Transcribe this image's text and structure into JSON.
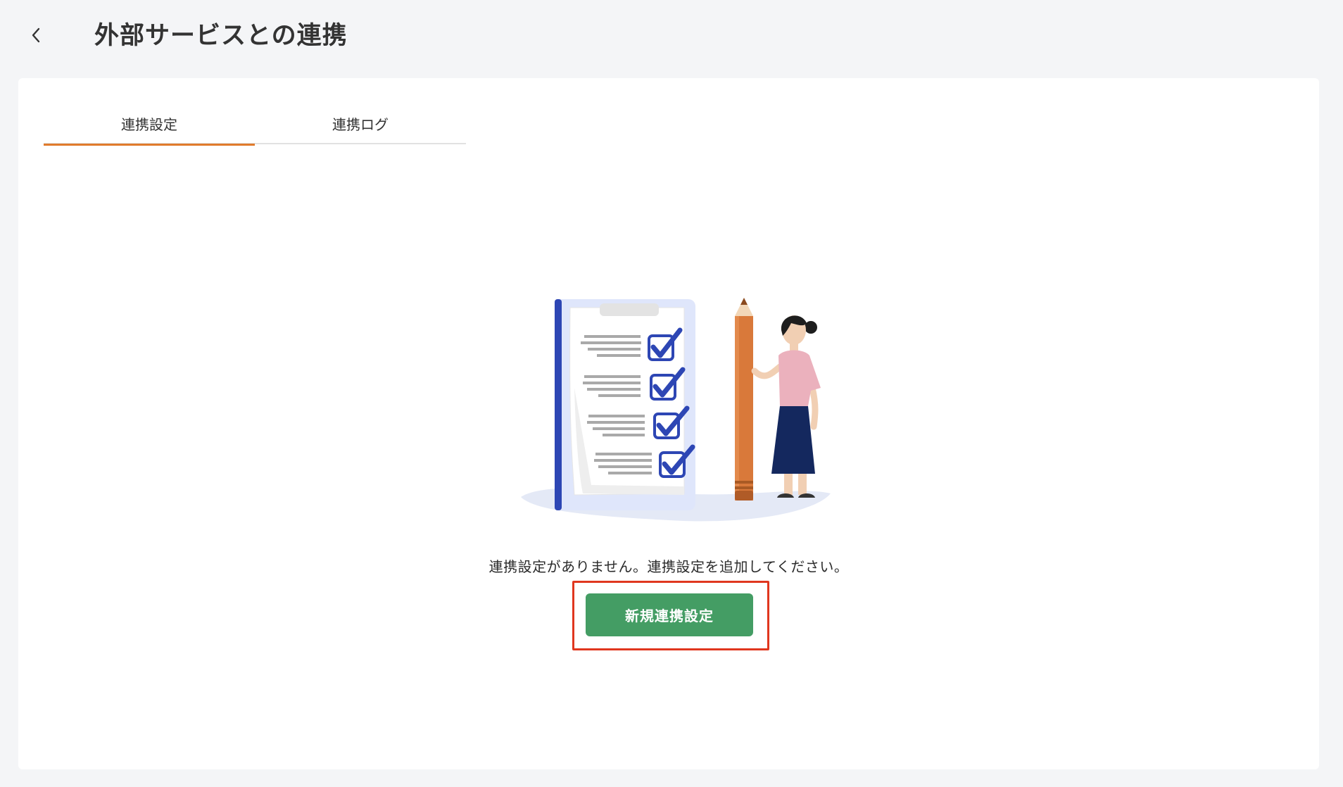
{
  "header": {
    "title": "外部サービスとの連携",
    "back_icon": "chevron-left-icon"
  },
  "tabs": [
    {
      "label": "連携設定",
      "active": true
    },
    {
      "label": "連携ログ",
      "active": false
    }
  ],
  "empty_state": {
    "illustration": "checklist-illustration",
    "message": "連携設定がありません。連携設定を追加してください。",
    "button_label": "新規連携設定"
  },
  "colors": {
    "accent": "#e07b2c",
    "primary_button": "#449d64",
    "highlight_border": "#e0371f",
    "background": "#f4f5f7"
  }
}
